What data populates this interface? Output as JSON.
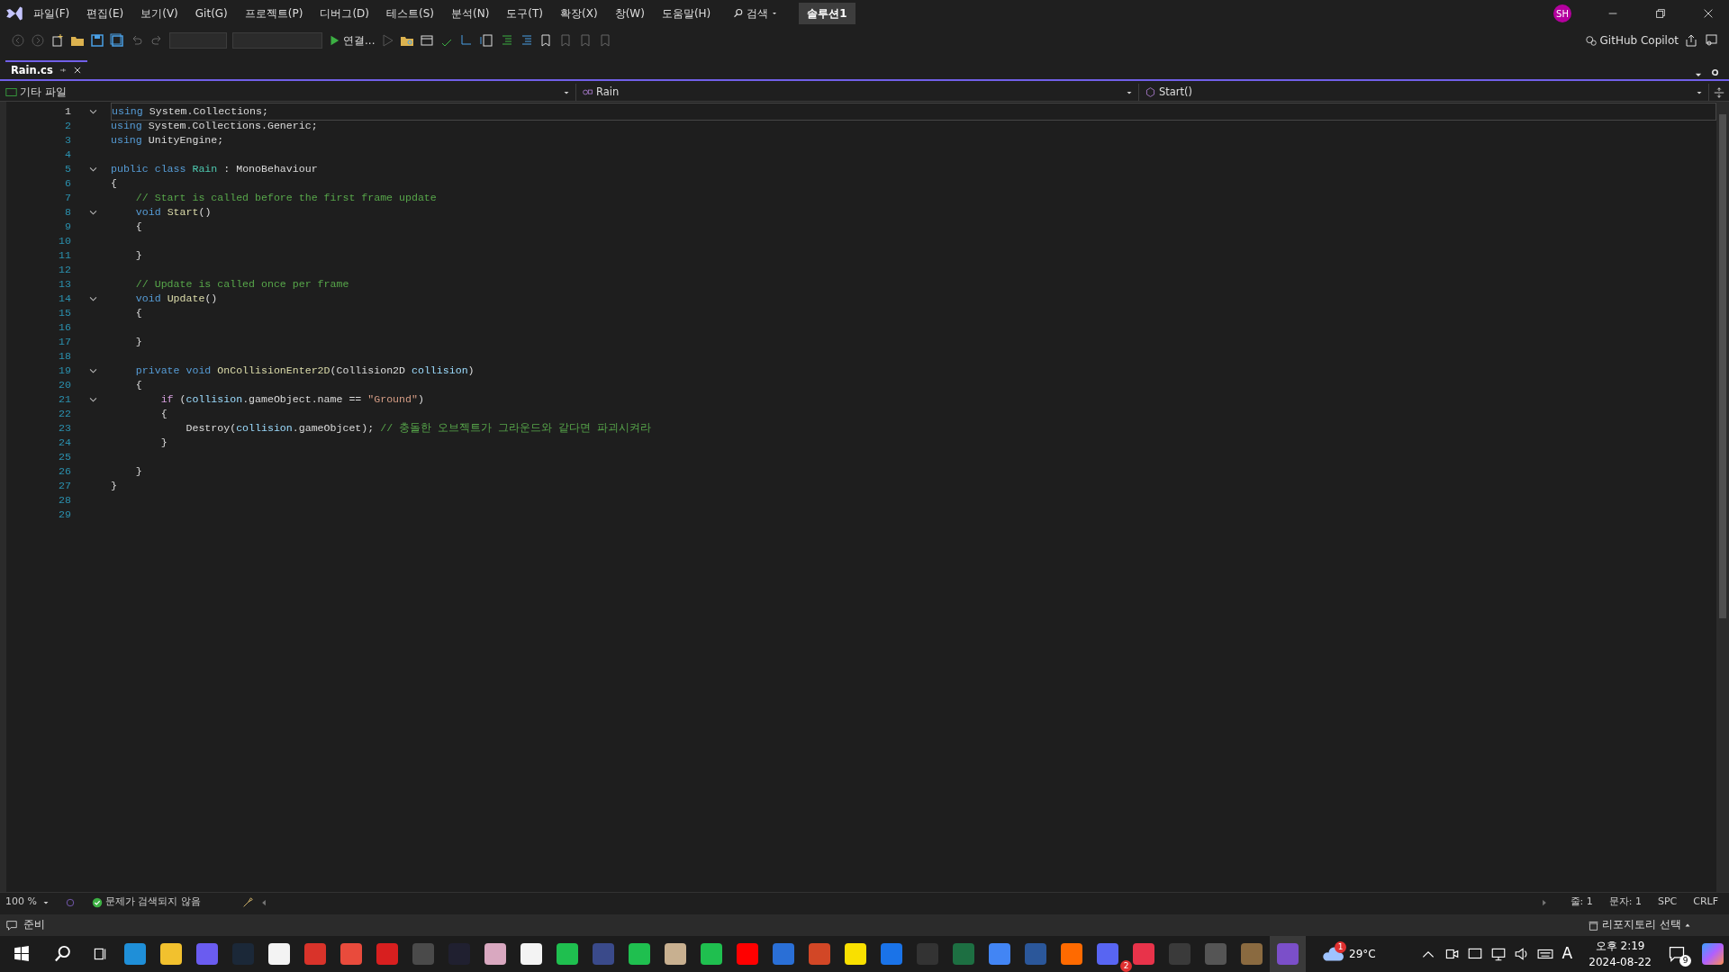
{
  "menu": [
    "파일(F)",
    "편집(E)",
    "보기(V)",
    "Git(G)",
    "프로젝트(P)",
    "디버그(D)",
    "테스트(S)",
    "분석(N)",
    "도구(T)",
    "확장(X)",
    "창(W)",
    "도움말(H)"
  ],
  "search": {
    "label": "검색"
  },
  "solution": "솔루션1",
  "avatar": "SH",
  "run_button": {
    "label": "연결..."
  },
  "copilot": "GitHub Copilot",
  "tabs": [
    {
      "label": "Rain.cs",
      "selected": true
    }
  ],
  "navbar": {
    "project": "기타 파일",
    "type": "Rain",
    "member": "Start()"
  },
  "code": [
    {
      "n": "1",
      "fold": true,
      "t": [
        {
          "kind": "keyword",
          "text": "using"
        },
        {
          "kind": "plain",
          "text": " System.Collections;"
        }
      ]
    },
    {
      "n": "2",
      "fold": false,
      "t": [
        {
          "kind": "keyword",
          "text": "using"
        },
        {
          "kind": "plain",
          "text": " System.Collections.Generic;"
        }
      ]
    },
    {
      "n": "3",
      "fold": false,
      "t": [
        {
          "kind": "keyword",
          "text": "using"
        },
        {
          "kind": "plain",
          "text": " UnityEngine;"
        }
      ]
    },
    {
      "n": "4",
      "fold": false
    },
    {
      "n": "5",
      "fold": true,
      "t": [
        {
          "kind": "keyword",
          "text": "public class "
        },
        {
          "kind": "type",
          "text": "Rain"
        },
        {
          "kind": "plain",
          "text": " : MonoBehaviour"
        }
      ]
    },
    {
      "n": "6",
      "fold": false,
      "t": [
        {
          "kind": "plain",
          "text": "{"
        }
      ]
    },
    {
      "n": "7",
      "fold": false,
      "t": [
        {
          "kind": "comment",
          "text": "    // Start is called before the first frame update"
        }
      ]
    },
    {
      "n": "8",
      "fold": true,
      "t": [
        {
          "kind": "keyword",
          "text": "    void "
        },
        {
          "kind": "method",
          "text": "Start"
        },
        {
          "kind": "plain",
          "text": "()"
        }
      ]
    },
    {
      "n": "9",
      "fold": false,
      "t": [
        {
          "kind": "plain",
          "text": "    {"
        }
      ]
    },
    {
      "n": "10",
      "fold": false
    },
    {
      "n": "11",
      "fold": false,
      "t": [
        {
          "kind": "plain",
          "text": "    }"
        }
      ]
    },
    {
      "n": "12",
      "fold": false
    },
    {
      "n": "13",
      "fold": false,
      "t": [
        {
          "kind": "comment",
          "text": "    // Update is called once per frame"
        }
      ]
    },
    {
      "n": "14",
      "fold": true,
      "t": [
        {
          "kind": "keyword",
          "text": "    void "
        },
        {
          "kind": "method",
          "text": "Update"
        },
        {
          "kind": "plain",
          "text": "()"
        }
      ]
    },
    {
      "n": "15",
      "fold": false,
      "t": [
        {
          "kind": "plain",
          "text": "    {"
        }
      ]
    },
    {
      "n": "16",
      "fold": false
    },
    {
      "n": "17",
      "fold": false,
      "t": [
        {
          "kind": "plain",
          "text": "    }"
        }
      ]
    },
    {
      "n": "18",
      "fold": false
    },
    {
      "n": "19",
      "fold": true,
      "t": [
        {
          "kind": "keyword",
          "text": "    private void "
        },
        {
          "kind": "method",
          "text": "OnCollisionEnter2D"
        },
        {
          "kind": "plain",
          "text": "(Collision2D "
        },
        {
          "kind": "parameter",
          "text": "collision"
        },
        {
          "kind": "plain",
          "text": ")"
        }
      ]
    },
    {
      "n": "20",
      "fold": false,
      "t": [
        {
          "kind": "plain",
          "text": "    {"
        }
      ]
    },
    {
      "n": "21",
      "fold": true,
      "t": [
        {
          "kind": "control",
          "text": "        if"
        },
        {
          "kind": "plain",
          "text": " ("
        },
        {
          "kind": "parameter",
          "text": "collision"
        },
        {
          "kind": "plain",
          "text": ".gameObject.name == "
        },
        {
          "kind": "string",
          "text": "\"Ground\""
        },
        {
          "kind": "plain",
          "text": ")"
        }
      ]
    },
    {
      "n": "22",
      "fold": false,
      "t": [
        {
          "kind": "plain",
          "text": "        {"
        }
      ]
    },
    {
      "n": "23",
      "fold": false,
      "t": [
        {
          "kind": "plain",
          "text": "            Destroy("
        },
        {
          "kind": "parameter",
          "text": "collision"
        },
        {
          "kind": "plain",
          "text": ".gameObjcet); "
        },
        {
          "kind": "comment",
          "text": "// 충돌한 오브젝트가 그라운드와 같다면 파괴시켜라"
        }
      ]
    },
    {
      "n": "24",
      "fold": false,
      "t": [
        {
          "kind": "plain",
          "text": "        }"
        }
      ]
    },
    {
      "n": "25",
      "fold": false
    },
    {
      "n": "26",
      "fold": false,
      "t": [
        {
          "kind": "plain",
          "text": "    }"
        }
      ]
    },
    {
      "n": "27",
      "fold": false,
      "t": [
        {
          "kind": "plain",
          "text": "}"
        }
      ]
    },
    {
      "n": "28",
      "fold": false
    },
    {
      "n": "29",
      "fold": false
    }
  ],
  "editor_status": {
    "zoom": "100 %",
    "issues": "문제가 검색되지 않음",
    "line": "줄: 1",
    "col": "문자: 1",
    "spacing": "SPC",
    "eol": "CRLF"
  },
  "status_bar": {
    "state": "준비",
    "repo": "리포지토리 선택"
  },
  "taskbar": {
    "apps": [
      {
        "color": "#1f8fd8",
        "selected": false
      },
      {
        "color": "#f2c12e",
        "selected": false
      },
      {
        "color": "#6a5cf0",
        "selected": false
      },
      {
        "color": "#1b2838",
        "selected": false
      },
      {
        "color": "#f3f3f3",
        "selected": false
      },
      {
        "color": "#d9332a",
        "selected": false
      },
      {
        "color": "#e94b3c",
        "selected": false
      },
      {
        "color": "#d81f1f",
        "selected": false
      },
      {
        "color": "#4a4a4a",
        "selected": false
      },
      {
        "color": "#202030",
        "selected": false
      },
      {
        "color": "#d9a8c0",
        "selected": false
      },
      {
        "color": "#f3f3f3",
        "selected": false
      },
      {
        "color": "#1fbf4f",
        "selected": false
      },
      {
        "color": "#3a4a8a",
        "selected": false
      },
      {
        "color": "#1fbf4f",
        "selected": false
      },
      {
        "color": "#c8b090",
        "selected": false
      },
      {
        "color": "#1fbf4f",
        "selected": false
      },
      {
        "color": "#ff0000",
        "selected": false
      },
      {
        "color": "#2a6fd6",
        "selected": false
      },
      {
        "color": "#d24726",
        "selected": false
      },
      {
        "color": "#f9e000",
        "selected": false
      },
      {
        "color": "#1a73e8",
        "selected": false
      },
      {
        "color": "#333333",
        "selected": false
      },
      {
        "color": "#1d6f42",
        "selected": false
      },
      {
        "color": "#4285f4",
        "selected": false
      },
      {
        "color": "#2b579a",
        "selected": false
      },
      {
        "color": "#ff6a00",
        "selected": false
      },
      {
        "color": "#5865f2",
        "selected": false
      },
      {
        "color": "#e8334a",
        "selected": false
      },
      {
        "color": "#3a3a3a",
        "selected": false
      },
      {
        "color": "#555555",
        "selected": false
      },
      {
        "color": "#8a6a40",
        "selected": false
      },
      {
        "color": "#7b4fc9",
        "selected": true
      }
    ],
    "discord_badge": "2",
    "weather_badge": "1",
    "temperature": "29°C",
    "ime": "A",
    "time": "오후 2:19",
    "date": "2024-08-22",
    "notifications": "9"
  }
}
